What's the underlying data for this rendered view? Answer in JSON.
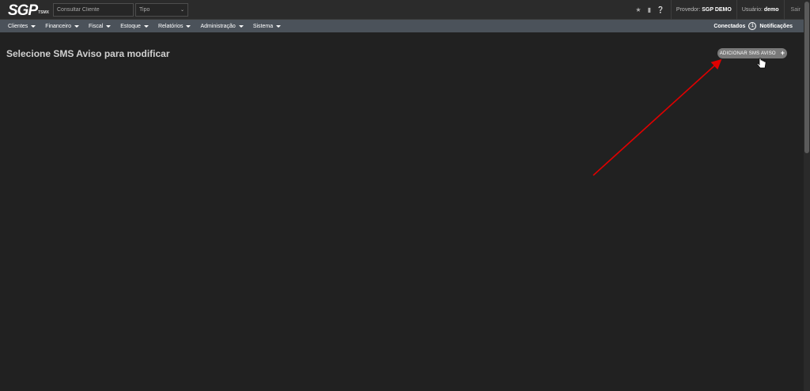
{
  "topbar": {
    "logo_main": "SGP",
    "logo_sub": "TSMX",
    "search_placeholder": "Consultar Cliente",
    "type_select_value": "Tipo",
    "icons": [
      "star-icon",
      "document-icon",
      "help-icon"
    ],
    "provider_label": "Provedor:",
    "provider_value": "SGP DEMO",
    "user_label": "Usuário:",
    "user_value": "demo",
    "logout_label": "Sair"
  },
  "navbar": {
    "items": [
      {
        "label": "Clientes"
      },
      {
        "label": "Financeiro"
      },
      {
        "label": "Fiscal"
      },
      {
        "label": "Estoque"
      },
      {
        "label": "Relatórios"
      },
      {
        "label": "Administração"
      },
      {
        "label": "Sistema"
      }
    ],
    "connected_label": "Conectados",
    "connected_count": "1",
    "notifications_label": "Notificações"
  },
  "main": {
    "title": "Selecione SMS Aviso para modificar",
    "add_button_label": "ADICIONAR SMS AVISO"
  },
  "colors": {
    "background": "#212121",
    "navbar": "#4b525a",
    "annotation_arrow": "#e00000"
  }
}
